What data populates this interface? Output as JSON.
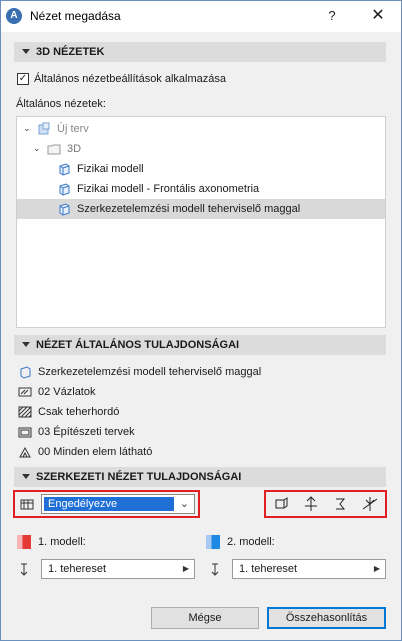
{
  "window": {
    "title": "Nézet megadása",
    "help_glyph": "?",
    "close_glyph": "✕",
    "app_icon_letter": "A"
  },
  "views_3d": {
    "header": "3D NÉZETEK",
    "checkbox_label": "Általános nézetbeállítások alkalmazása",
    "checkbox_checked": true,
    "list_label": "Általános nézetek:",
    "tree": [
      {
        "label": "Új terv",
        "icon": "project-icon",
        "expanded": true
      },
      {
        "label": "3D",
        "icon": "folder-icon",
        "expanded": true
      },
      {
        "label": "Fizikai modell",
        "icon": "view-cube-icon"
      },
      {
        "label": "Fizikai modell - Frontális axonometria",
        "icon": "view-cube-icon"
      },
      {
        "label": "Szerkezetelemzési modell teherviselő maggal",
        "icon": "view-cube-icon",
        "selected": true
      }
    ]
  },
  "general_props": {
    "header": "NÉZET ÁLTALÁNOS TULAJDONSÁGAI",
    "rows": [
      {
        "icon": "analytical-model-icon",
        "label": "Szerkezetelemzési modell teherviselő maggal"
      },
      {
        "icon": "pen-set-icon",
        "label": "02 Vázlatok"
      },
      {
        "icon": "hatch-icon",
        "label": "Csak teherhordó"
      },
      {
        "icon": "layer-combination-icon",
        "label": "03 Építészeti tervek"
      },
      {
        "icon": "renovation-filter-icon",
        "label": "00 Minden elem látható"
      }
    ]
  },
  "structural_props": {
    "header": "SZERKEZETI NÉZET TULAJDONSÁGAI",
    "mode_value": "Engedélyezve",
    "toolbar_icons": [
      "structural-display-icon",
      "support-icon",
      "load-icon",
      "release-icon"
    ],
    "model1_label": "1. modell:",
    "model2_label": "2. modell:",
    "model1_color": "#e53935",
    "model2_color": "#1e88e5",
    "model1_load": "1. tehereset",
    "model2_load": "1. tehereset"
  },
  "buttons": {
    "cancel": "Mégse",
    "compare": "Összehasonlítás"
  }
}
